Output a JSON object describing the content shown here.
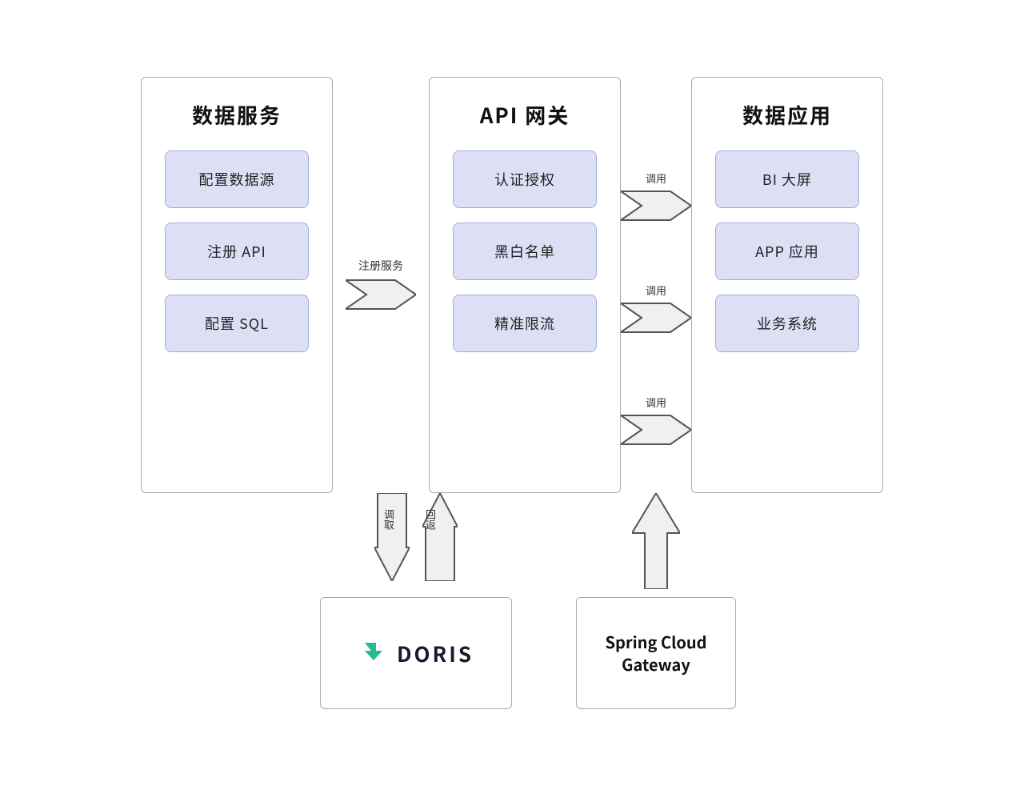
{
  "panels": {
    "left": {
      "title": "数据服务",
      "boxes": [
        "配置数据源",
        "注册 API",
        "配置 SQL"
      ]
    },
    "mid": {
      "title": "API 网关",
      "boxes": [
        "认证授权",
        "黑白名单",
        "精准限流"
      ]
    },
    "right": {
      "title": "数据应用",
      "boxes": [
        "BI 大屏",
        "APP 应用",
        "业务系统"
      ]
    }
  },
  "arrows": {
    "left_to_mid": "注册服务",
    "mid_to_right": [
      "调用",
      "调用",
      "调用"
    ],
    "down_label": "调取",
    "up_label": "回返"
  },
  "doris": {
    "name": "DORIS"
  },
  "gateway": {
    "text": "Spring Cloud\nGateway"
  }
}
